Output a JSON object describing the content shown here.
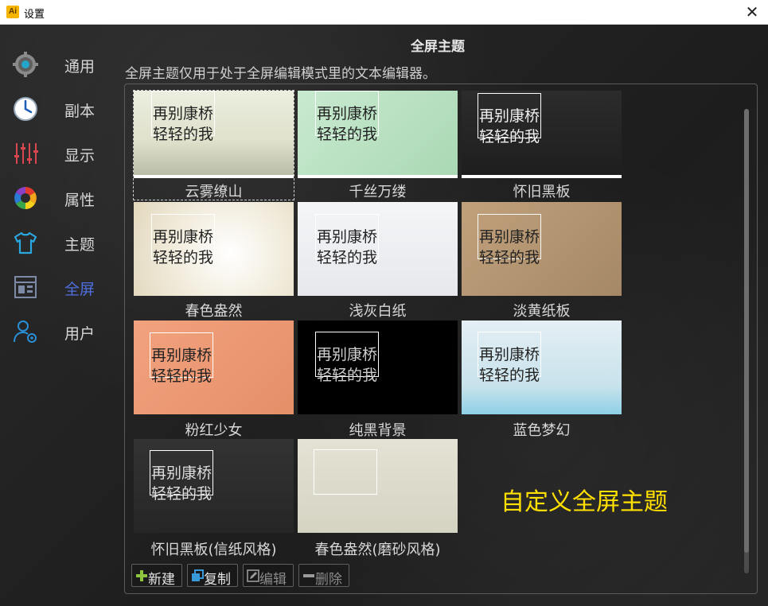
{
  "window": {
    "title": "设置",
    "app_icon": "Ai"
  },
  "sidebar": {
    "items": [
      {
        "label": "通用",
        "icon": "gear-icon",
        "active": false
      },
      {
        "label": "副本",
        "icon": "clock-icon",
        "active": false
      },
      {
        "label": "显示",
        "icon": "sliders-icon",
        "active": false
      },
      {
        "label": "属性",
        "icon": "color-wheel-icon",
        "active": false
      },
      {
        "label": "主题",
        "icon": "tshirt-icon",
        "active": false
      },
      {
        "label": "全屏",
        "icon": "fullscreen-icon",
        "active": true
      },
      {
        "label": "用户",
        "icon": "user-settings-icon",
        "active": false
      }
    ]
  },
  "page": {
    "title": "全屏主题",
    "description": "全屏主题仅用于处于全屏编辑模式里的文本编辑器。"
  },
  "preview_text": {
    "line1": "再别康桥",
    "line2": "轻轻的我"
  },
  "themes": [
    {
      "name": "云雾缭山",
      "selected": true,
      "text_color": "#222222",
      "bg": "#e2e3cf"
    },
    {
      "name": "千丝万缕",
      "selected": false,
      "text_color": "#222222",
      "bg": "#bfe0c6"
    },
    {
      "name": "怀旧黑板",
      "selected": false,
      "text_color": "#f0f0f0",
      "bg": "#2b2b2b"
    },
    {
      "name": "春色盎然",
      "selected": false,
      "text_color": "#222222",
      "bg": "#f1ecd9"
    },
    {
      "name": "浅灰白纸",
      "selected": false,
      "text_color": "#222222",
      "bg": "#eef0f3"
    },
    {
      "name": "淡黄纸板",
      "selected": false,
      "text_color": "#222222",
      "bg": "#b89a75"
    },
    {
      "name": "粉红少女",
      "selected": false,
      "text_color": "#222222",
      "bg": "#ee9b76"
    },
    {
      "name": "纯黑背景",
      "selected": false,
      "text_color": "#cfcfcf",
      "bg": "#000000"
    },
    {
      "name": "蓝色梦幻",
      "selected": false,
      "text_color": "#222222",
      "bg": "#c9e0ea"
    },
    {
      "name": "怀旧黑板(信纸风格)",
      "selected": false,
      "text_color": "#dedede",
      "bg": "#2f2f2f"
    },
    {
      "name": "春色盎然(磨砂风格)",
      "selected": false,
      "text_color": "#222222",
      "bg": "#dedccc",
      "no_text": true
    }
  ],
  "custom_theme": {
    "label": "自定义全屏主题",
    "color": "#ffe000"
  },
  "toolbar": {
    "new_label": "新建",
    "copy_label": "复制",
    "edit_label": "编辑",
    "delete_label": "删除"
  },
  "colors": {
    "active_nav": "#4f6fe0",
    "new_icon": "#8ec63f",
    "copy_icon": "#3a9ad9"
  }
}
